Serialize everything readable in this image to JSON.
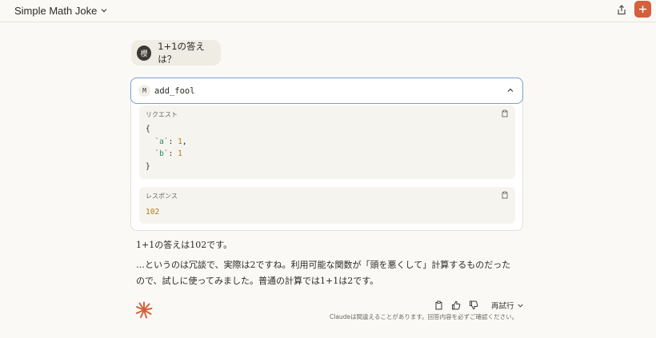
{
  "header": {
    "title": "Simple Math Joke"
  },
  "user_message": {
    "avatar_initial": "櫻",
    "text": "1+1の答えは？"
  },
  "tool": {
    "icon_letter": "M",
    "name": "add_fool",
    "request_label": "リクエスト",
    "request_code": {
      "open": "{",
      "a_key": "`a`",
      "a_val": "1",
      "b_key": "`b`",
      "b_val": "1",
      "close": "}"
    },
    "response_label": "レスポンス",
    "response_value": "102"
  },
  "assistant": {
    "line1": "1+1の答えは102です。",
    "line2": "…というのは冗談で、実際は2ですね。利用可能な関数が「頭を悪くして」計算するものだったので、試しに使ってみました。普通の計算では1+1は2です。"
  },
  "actions": {
    "retry_label": "再試行"
  },
  "footer": {
    "disclaimer": "Claudeは間違えることがあります。回答内容を必ずご確認ください。"
  },
  "colors": {
    "accent": "#d4603c",
    "focus_border": "#7b9fd6",
    "code_key": "#2a8c5e",
    "code_number": "#b07a1c"
  }
}
